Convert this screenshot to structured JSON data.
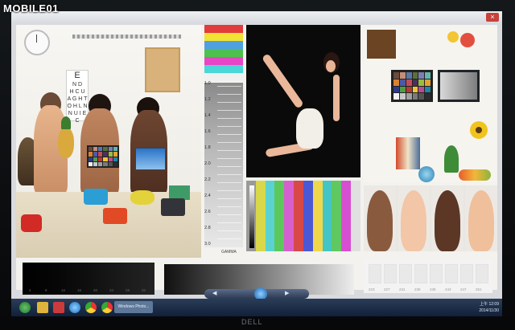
{
  "watermark": "MOBILE01",
  "window": {
    "close_glyph": "×"
  },
  "poster": {
    "eye_chart_lines": [
      "E",
      "N D",
      "H C U",
      "A G H T",
      "O H L N",
      "N U I E C"
    ]
  },
  "gray_scale": {
    "ticks": [
      "1.0",
      "1.2",
      "1.4",
      "1.6",
      "1.8",
      "2.0",
      "2.2",
      "2.4",
      "2.6",
      "2.8",
      "3.0"
    ],
    "label": "GAMMA"
  },
  "black_steps": [
    "4",
    "8",
    "12",
    "16",
    "20",
    "24",
    "28",
    "32"
  ],
  "white_steps": [
    "223",
    "227",
    "231",
    "235",
    "239",
    "243",
    "247",
    "251"
  ],
  "taskbar": {
    "active_label": "Windows Photo...",
    "tray_time": "上午 12:09",
    "tray_date": "2014/11/30"
  },
  "brand": "DELL",
  "colors": {
    "test_bars": [
      "#e23b3b",
      "#f2e233",
      "#4fa0e0",
      "#4cc24c",
      "#e846c7",
      "#49d7d7",
      "#f0f0f0"
    ],
    "wide_bars": [
      "#9a9a9a",
      "#d8d84a",
      "#5ad2d2",
      "#5cc85c",
      "#d65fcf",
      "#d84848",
      "#4a58d4",
      "#f0d64a",
      "#44c5c5",
      "#60c860",
      "#d64fd0",
      "#e0e0e0"
    ]
  }
}
